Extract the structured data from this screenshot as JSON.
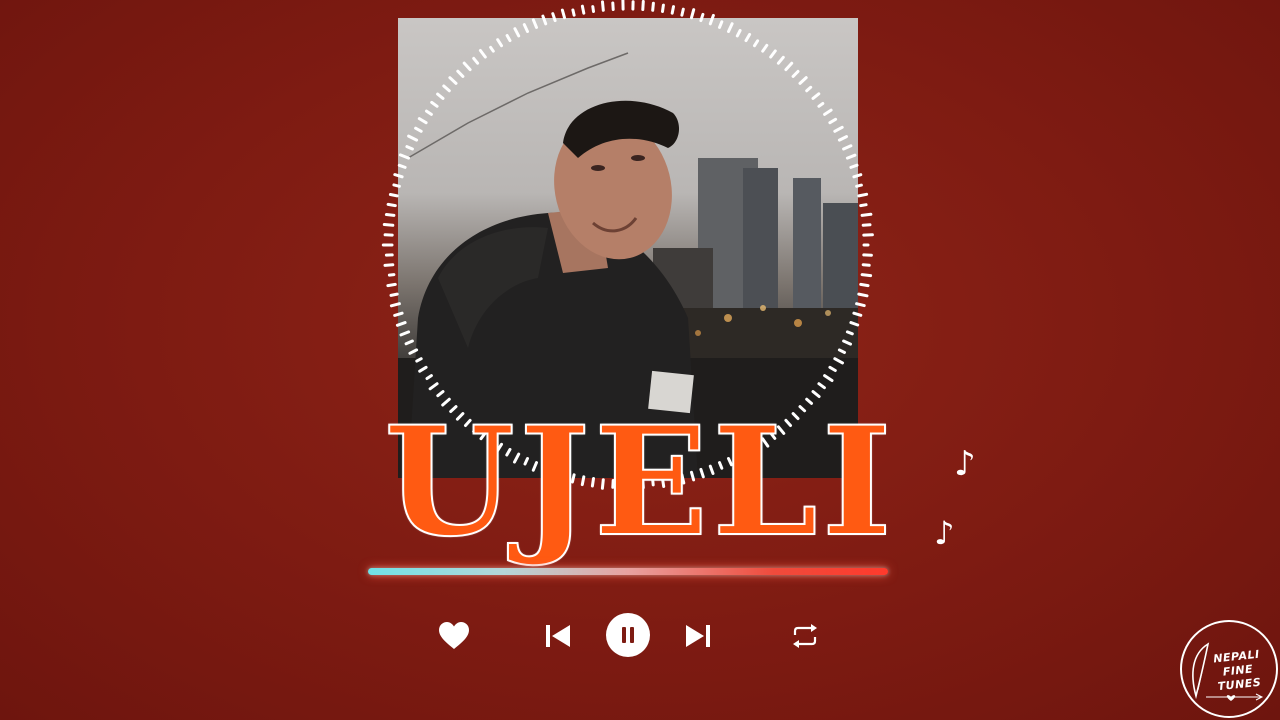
{
  "song": {
    "title": "UJELI"
  },
  "player": {
    "progress_fraction": 1.0,
    "state": "playing",
    "controls": {
      "like_icon": "heart-icon",
      "previous_icon": "skip-previous-icon",
      "play_pause_icon": "pause-icon",
      "next_icon": "skip-next-icon",
      "repeat_icon": "repeat-icon"
    }
  },
  "decorations": {
    "note_glyph_1": "♪",
    "note_glyph_2": "♪"
  },
  "logo": {
    "line1": "NEPALI",
    "line2": "FINE TUNES"
  },
  "colors": {
    "background": "#7e1b12",
    "title_fill": "#ff5a12",
    "title_outline": "#ffffff",
    "progress_start": "#6fe2e7",
    "progress_end": "#ff3a2c"
  }
}
